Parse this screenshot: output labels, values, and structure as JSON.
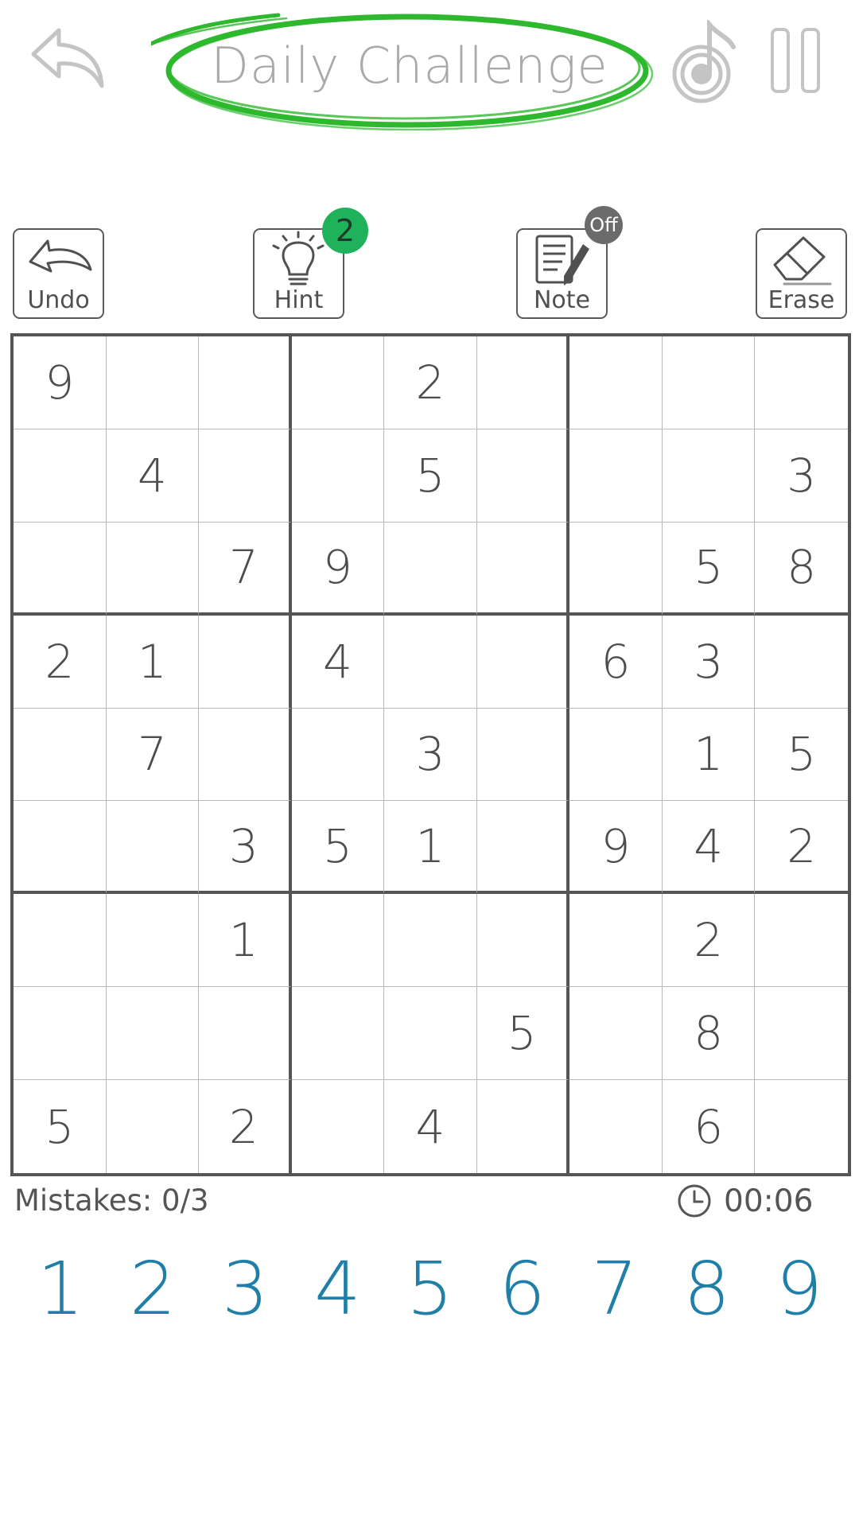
{
  "header": {
    "title": "Daily Challenge",
    "title_highlight_color": "#2eb82e",
    "icons": [
      "back-arrow-icon",
      "music-note-icon",
      "pause-icon"
    ]
  },
  "tools": {
    "undo_label": "Undo",
    "hint_label": "Hint",
    "hint_count": "2",
    "note_label": "Note",
    "note_state": "Off",
    "erase_label": "Erase"
  },
  "grid": {
    "rows": [
      [
        "9",
        "",
        "",
        "",
        "2",
        "",
        "",
        "",
        ""
      ],
      [
        "",
        "4",
        "",
        "",
        "5",
        "",
        "",
        "",
        "3"
      ],
      [
        "",
        "",
        "7",
        "9",
        "",
        "",
        "",
        "5",
        "8"
      ],
      [
        "2",
        "1",
        "",
        "4",
        "",
        "",
        "6",
        "3",
        ""
      ],
      [
        "",
        "7",
        "",
        "",
        "3",
        "",
        "",
        "1",
        "5"
      ],
      [
        "",
        "",
        "3",
        "5",
        "1",
        "",
        "9",
        "4",
        "2"
      ],
      [
        "",
        "",
        "1",
        "",
        "",
        "",
        "",
        "2",
        ""
      ],
      [
        "",
        "",
        "",
        "",
        "",
        "5",
        "",
        "8",
        ""
      ],
      [
        "5",
        "",
        "2",
        "",
        "4",
        "",
        "",
        "6",
        ""
      ]
    ]
  },
  "status": {
    "mistakes": "Mistakes: 0/3",
    "timer": "00:06"
  },
  "numpad": [
    "1",
    "2",
    "3",
    "4",
    "5",
    "6",
    "7",
    "8",
    "9"
  ],
  "colors": {
    "numpad": "#1f7fa8",
    "hint_badge": "#1fb25a",
    "note_badge": "#6b6b6b",
    "grid_border": "#555555"
  }
}
